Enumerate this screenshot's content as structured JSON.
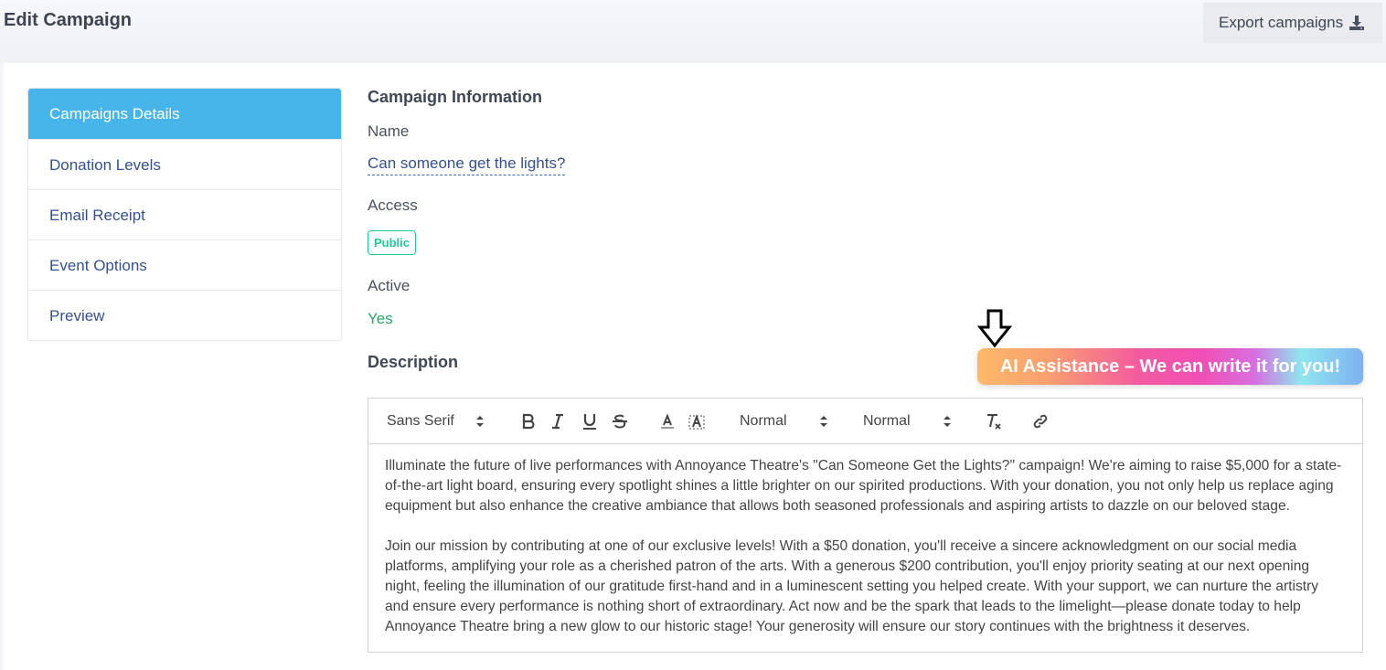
{
  "header": {
    "title": "Edit Campaign",
    "export_label": "Export campaigns"
  },
  "sidebar": {
    "items": [
      {
        "label": "Campaigns Details",
        "active": true
      },
      {
        "label": "Donation Levels",
        "active": false
      },
      {
        "label": "Email Receipt",
        "active": false
      },
      {
        "label": "Event Options",
        "active": false
      },
      {
        "label": "Preview",
        "active": false
      }
    ]
  },
  "campaign": {
    "section_title": "Campaign Information",
    "name_label": "Name",
    "name_value": "Can someone get the lights?",
    "access_label": "Access",
    "access_value": "Public",
    "active_label": "Active",
    "active_value": "Yes",
    "description_label": "Description"
  },
  "ai_button": {
    "label": "AI Assistance – We can write it for you!"
  },
  "editor": {
    "font_select": "Sans Serif",
    "size_select": "Normal",
    "header_select": "Normal",
    "paragraphs": [
      "Illuminate the future of live performances with Annoyance Theatre's \"Can Someone Get the Lights?\" campaign! We're aiming to raise $5,000 for a state-of-the-art light board, ensuring every spotlight shines a little brighter on our spirited productions. With your donation, you not only help us replace aging equipment but also enhance the creative ambiance that allows both seasoned professionals and aspiring artists to dazzle on our beloved stage.",
      "Join our mission by contributing at one of our exclusive levels! With a $50 donation, you'll receive a sincere acknowledgment on our social media platforms, amplifying your role as a cherished patron of the arts. With a generous $200 contribution, you'll enjoy priority seating at our next opening night, feeling the illumination of our gratitude first-hand and in a luminescent setting you helped create. With your support, we can nurture the artistry and ensure every performance is nothing short of extraordinary. Act now and be the spark that leads to the limelight—please donate today to help Annoyance Theatre bring a new glow to our historic stage! Your generosity will ensure our story continues with the brightness it deserves."
    ]
  },
  "colors": {
    "accent": "#47b5ea",
    "link": "#34508e",
    "success": "#20c997",
    "active_green": "#2ea36b"
  }
}
